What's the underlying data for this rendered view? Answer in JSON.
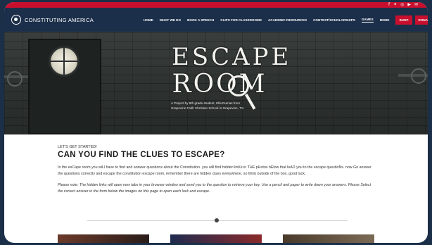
{
  "site": {
    "logo_text": "CONSTITUTING AMERICA"
  },
  "social": {
    "icons": [
      "f",
      "t",
      "ig",
      "yt",
      "em"
    ]
  },
  "nav": {
    "items": [
      {
        "label": "HOME"
      },
      {
        "label": "WHAT WE DO"
      },
      {
        "label": "BOOK A SPEECH"
      },
      {
        "label": "CLIPS FOR CLASSROOMS"
      },
      {
        "label": "ACADEMIC RESOURCES"
      },
      {
        "label": "CONTEST/SCHOLARSHIPS"
      },
      {
        "label": "GAMES",
        "active": true
      },
      {
        "label": "MORE"
      }
    ],
    "shop_label": "SHOP",
    "donate_label": "DONATE",
    "search_icon": "search-icon"
  },
  "hero": {
    "title_line1": "ESCAPE",
    "title_line2": "ROOM",
    "credit": "A Project by 6th grade student, Ella Dumas from Grapevine Faith Christian School in Grapevine, TX."
  },
  "content": {
    "eyebrow": "LET'S GET STARTED!",
    "heading": "CAN YOU FIND THE CLUES TO ESCAPE?",
    "paragraph": "In the esCape room you wiLl have to find and answer questions about the Constitution. you will find hidden linKs in THE pHotos bElow that leAD you to the escape questioNs. now Go answer the questions correctly and escape the constitution escape room. remember there are hidden clues everywhere, so think outside of the box. good luck.",
    "note": "Please note: The hidden links will open new tabs in your browser window and send you to the question to retrieve your key. Use a pencil and paper to write down your answers. Please Select the correct answer in the form below the images on this page to open each lock and escape."
  },
  "colors": {
    "nav_bg": "#1c2f4a",
    "accent_red": "#c8102e",
    "frame_bg": "#1b2f48"
  }
}
